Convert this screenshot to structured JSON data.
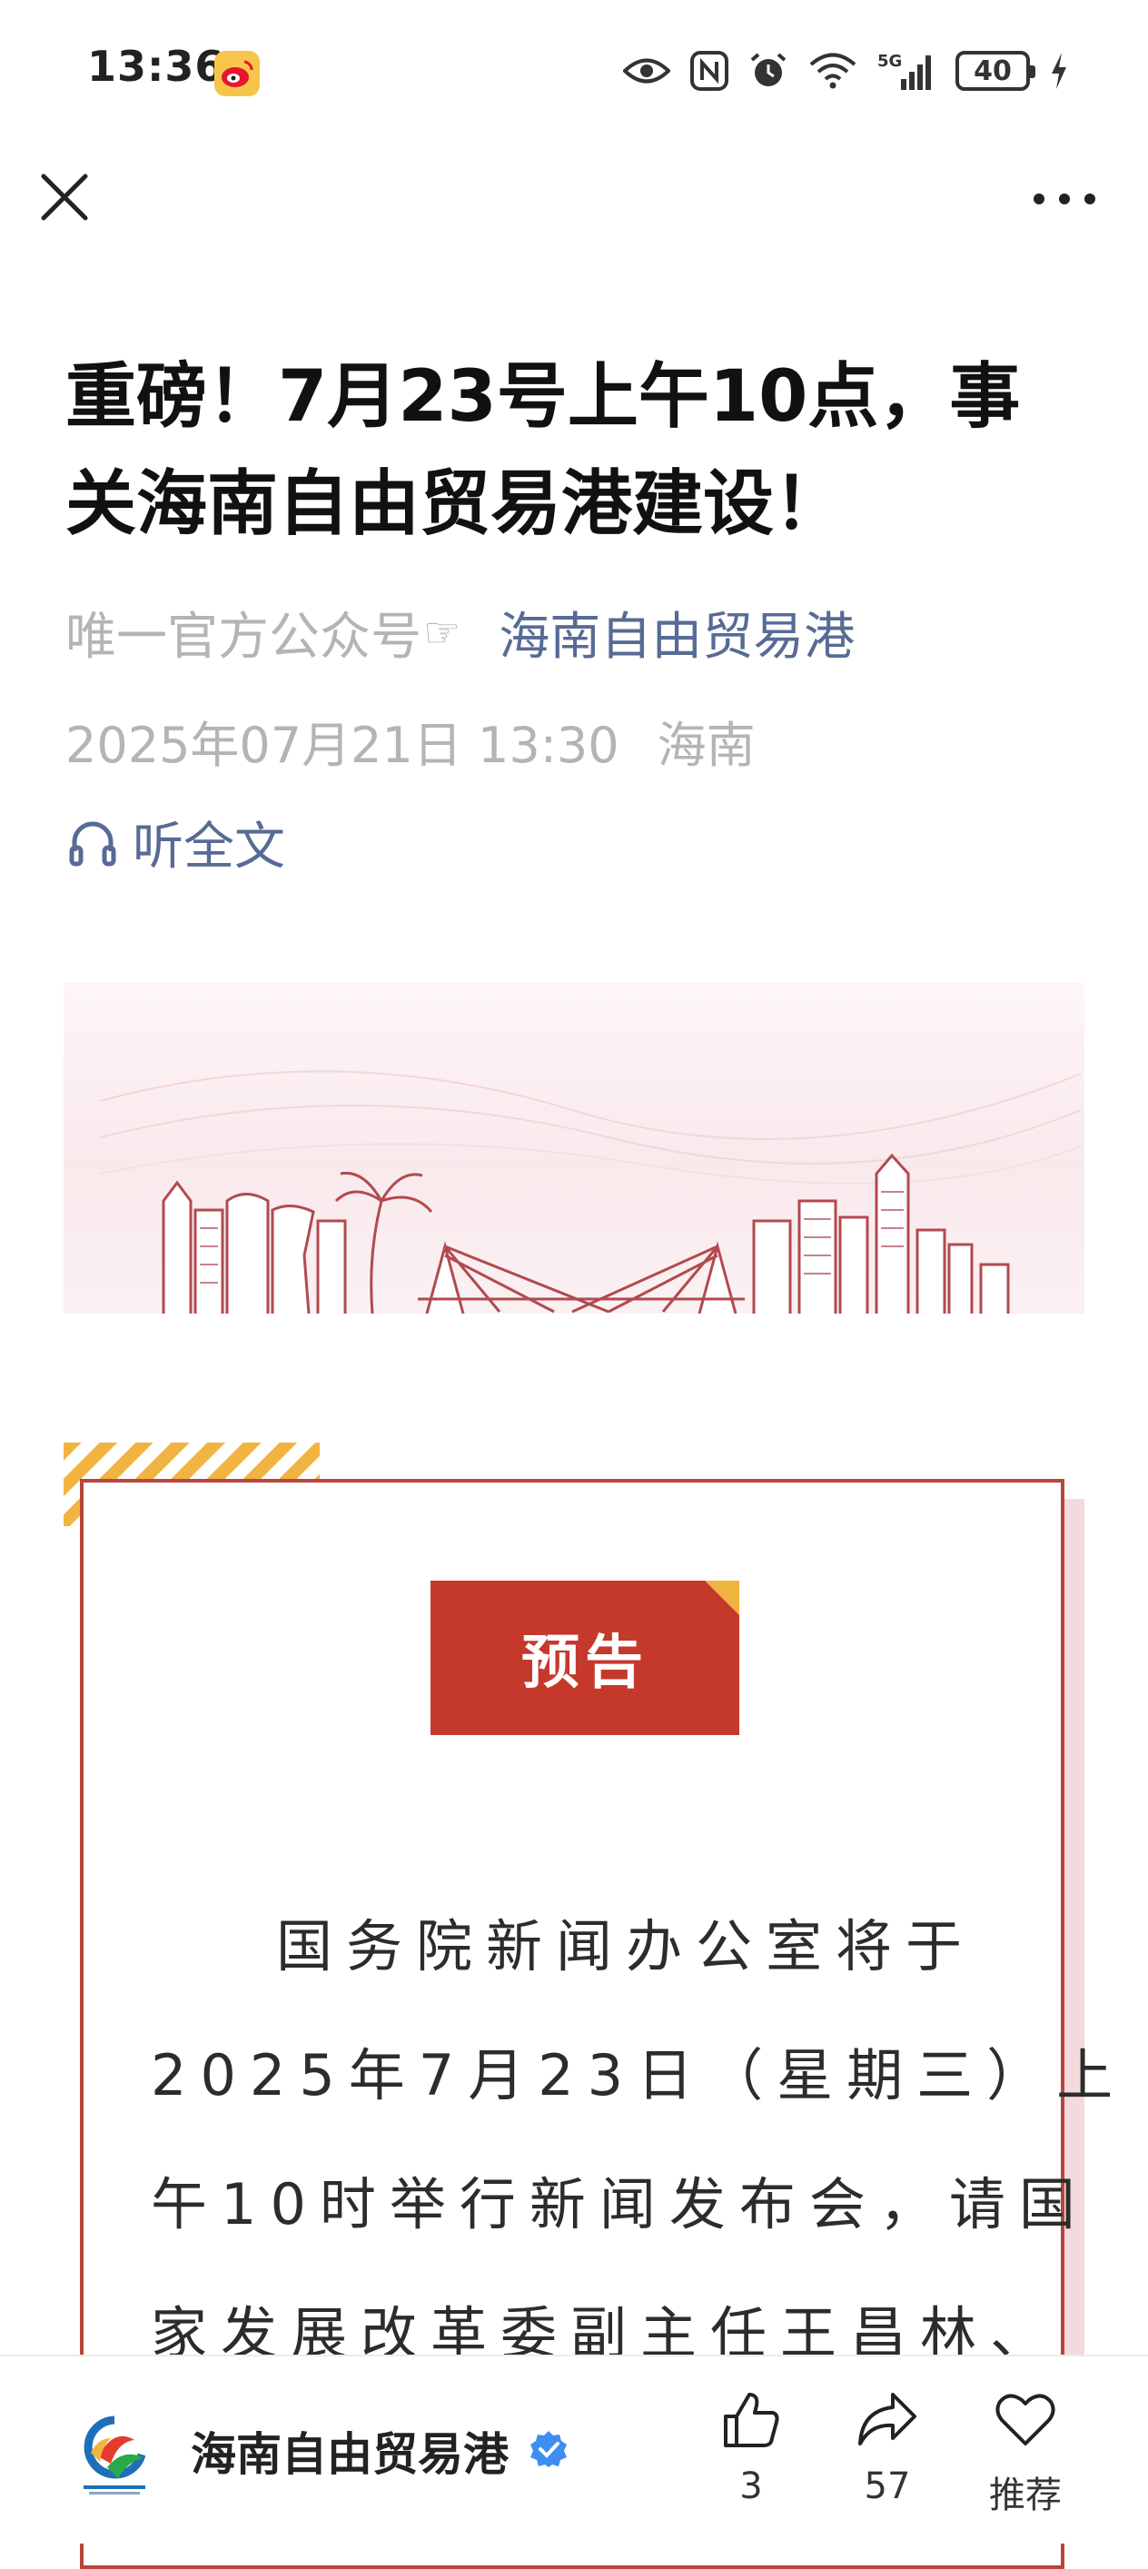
{
  "status_bar": {
    "time": "13:36",
    "battery": "40",
    "network": "5G",
    "icons": [
      "weibo-icon",
      "eye-icon",
      "nfc-icon",
      "alarm-icon",
      "wifi-icon",
      "signal-icon",
      "battery-icon",
      "charging-icon"
    ]
  },
  "nav": {
    "close_icon": "close-icon",
    "more_icon": "more-icon"
  },
  "article": {
    "title": "重磅！7月23号上午10点，事关海南自由贸易港建设！",
    "author_tag": "唯一官方公众号",
    "hand_glyph": "☞",
    "account_name": "海南自由贸易港",
    "date": "2025年07月21日 13:30",
    "location": "海南",
    "listen_label": "听全文"
  },
  "notice": {
    "label": "预告",
    "lines": [
      "国务院新闻办公室将于",
      "2025年7月23日（星期三）上",
      "午10时举行新闻发布会，请国",
      "家发展改革委副主任王昌林、"
    ]
  },
  "bottom_bar": {
    "account_name": "海南自由贸易港",
    "like_count": "3",
    "share_count": "57",
    "recommend_label": "推荐"
  },
  "colors": {
    "link": "#576b95",
    "accent_red": "#c5392d",
    "accent_gold": "#f2b441",
    "muted": "#b4b4b4"
  }
}
